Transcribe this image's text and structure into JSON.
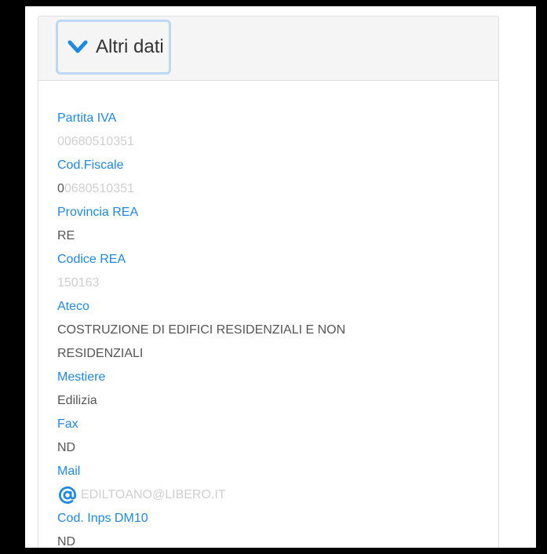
{
  "section": {
    "title": "Altri dati",
    "toggle_icon": "chevron-down-icon"
  },
  "fields": {
    "partita_iva": {
      "label": "Partita IVA",
      "value": "00680510351"
    },
    "cod_fiscale": {
      "label": "Cod.Fiscale",
      "value_first": "0",
      "value_rest": "0680510351"
    },
    "provincia_rea": {
      "label": "Provincia REA",
      "value": "RE"
    },
    "codice_rea": {
      "label": "Codice REA",
      "value": "150163"
    },
    "ateco": {
      "label": "Ateco",
      "value": "COSTRUZIONE DI EDIFICI RESIDENZIALI E NON RESIDENZIALI"
    },
    "mestiere": {
      "label": "Mestiere",
      "value": "Edilizia"
    },
    "fax": {
      "label": "Fax",
      "value": "ND"
    },
    "mail": {
      "label": "Mail",
      "value": "EDILTOANO@LIBERO.IT",
      "icon": "at-icon"
    },
    "cod_inps": {
      "label": "Cod. Inps DM10",
      "value": "ND"
    }
  },
  "colors": {
    "label": "#1e88e5",
    "value": "#555555",
    "value_light": "#cfcfcf",
    "focus_border": "#bcd8f5"
  }
}
